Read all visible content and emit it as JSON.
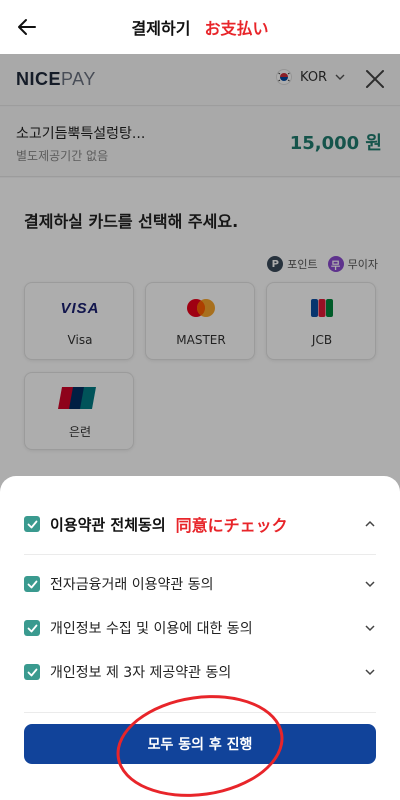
{
  "topbar": {
    "title": "결제하기",
    "annotation": "お支払い"
  },
  "nicepay": {
    "logo_bold": "NICE",
    "logo_light": "PAY",
    "language": "KOR"
  },
  "product": {
    "name": "소고기듬뿍특설렁탕...",
    "subtitle": "별도제공기간 없음",
    "amount": "15,000 원"
  },
  "card_section": {
    "title": "결제하실 카드를 선택해 주세요.",
    "tags": [
      {
        "icon": "P",
        "label": "포인트",
        "color": "#3a4a5a"
      },
      {
        "icon": "무",
        "label": "무이자",
        "color": "#8b4bd0"
      }
    ],
    "cards": [
      {
        "logo": "VISA",
        "label": "Visa"
      },
      {
        "logo": "mastercard",
        "label": "MASTER"
      },
      {
        "logo": "JCB",
        "label": "JCB"
      },
      {
        "logo": "UnionPay",
        "label": "은련"
      }
    ]
  },
  "agreement": {
    "all_label": "이용약관 전체동의",
    "annotation": "同意にチェック",
    "items": [
      {
        "label": "전자금융거래 이용약관 동의"
      },
      {
        "label": "개인정보 수집 및 이용에 대한 동의"
      },
      {
        "label": "개인정보 제 3자 제공약관 동의"
      }
    ],
    "cta_label": "모두 동의 후 진행"
  },
  "colors": {
    "accent_teal": "#3a9a8f",
    "cta_blue": "#11439a",
    "annotation_red": "#e8252a",
    "amount_green": "#1f7c6f"
  }
}
